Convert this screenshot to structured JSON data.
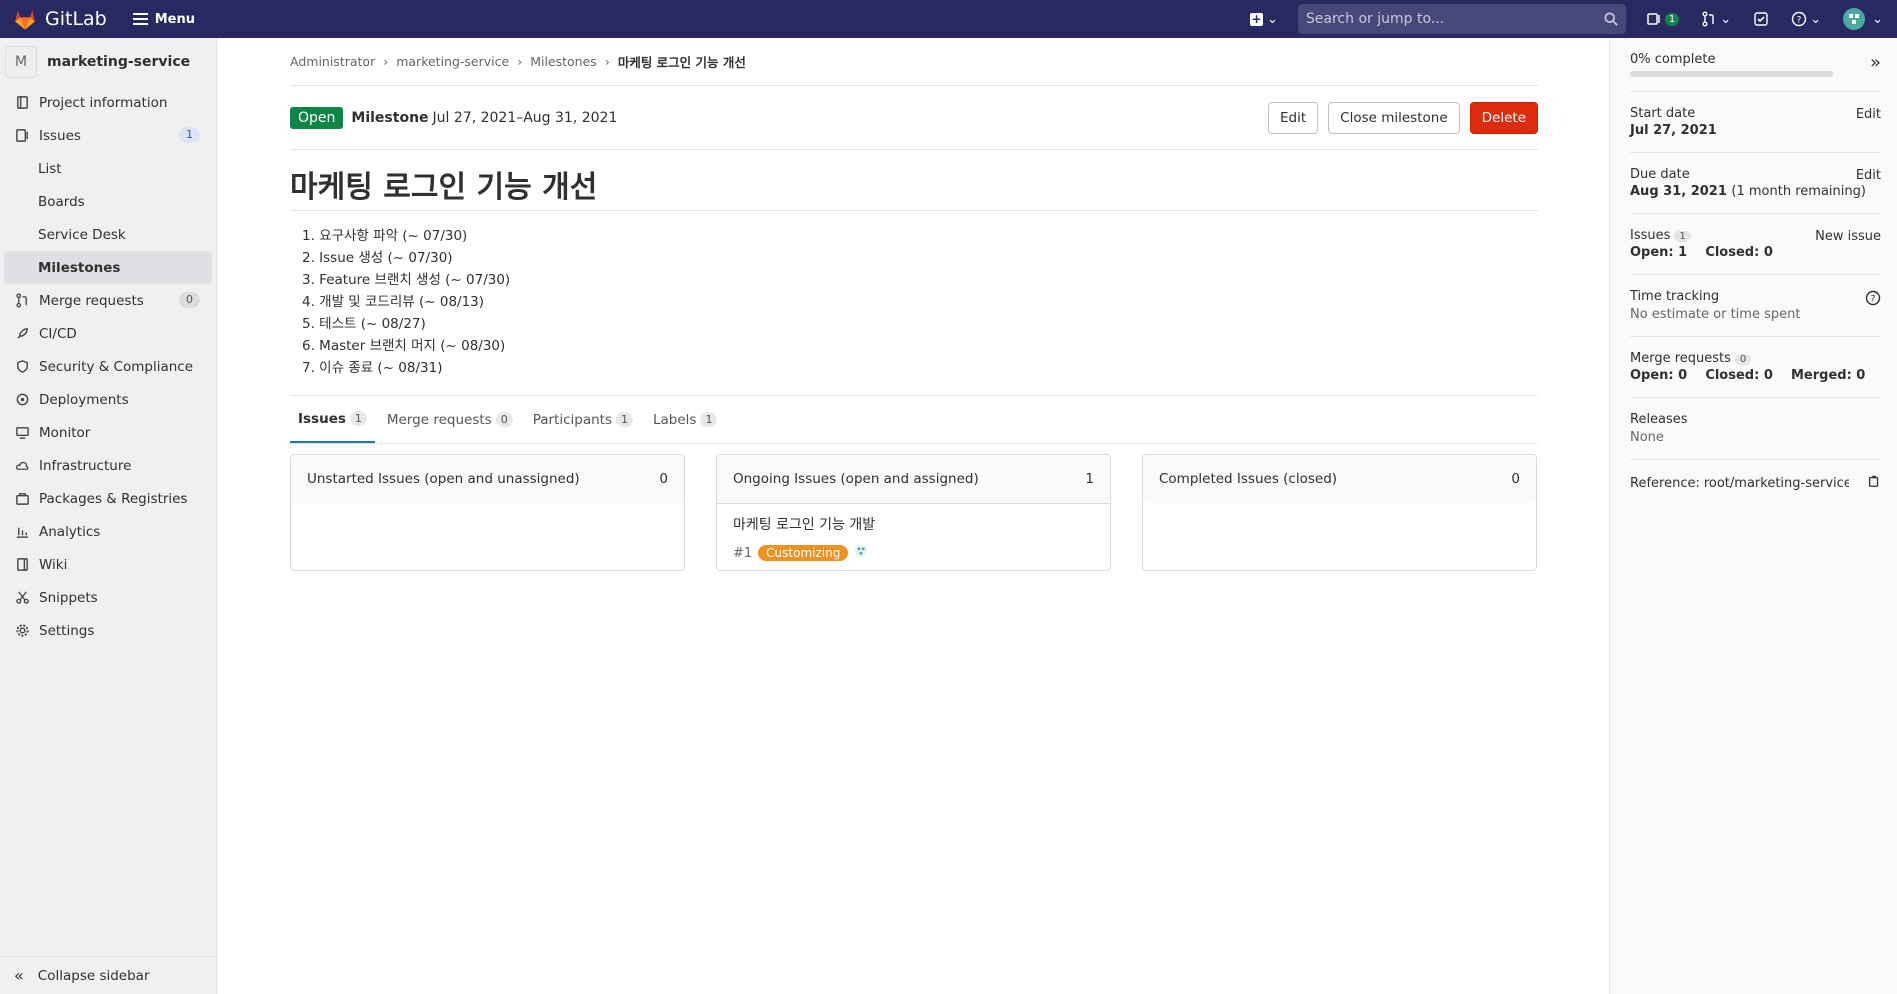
{
  "topbar": {
    "app_name": "GitLab",
    "menu_label": "Menu",
    "search_placeholder": "Search or jump to...",
    "issues_badge": "1"
  },
  "sidebar": {
    "project_initial": "M",
    "project_name": "marketing-service",
    "items": [
      {
        "label": "Project information"
      },
      {
        "label": "Issues",
        "count": "1"
      },
      {
        "label": "Merge requests",
        "count": "0"
      },
      {
        "label": "CI/CD"
      },
      {
        "label": "Security & Compliance"
      },
      {
        "label": "Deployments"
      },
      {
        "label": "Monitor"
      },
      {
        "label": "Infrastructure"
      },
      {
        "label": "Packages & Registries"
      },
      {
        "label": "Analytics"
      },
      {
        "label": "Wiki"
      },
      {
        "label": "Snippets"
      },
      {
        "label": "Settings"
      }
    ],
    "issue_subitems": [
      "List",
      "Boards",
      "Service Desk",
      "Milestones"
    ],
    "collapse_label": "Collapse sidebar"
  },
  "breadcrumb": [
    "Administrator",
    "marketing-service",
    "Milestones",
    "마케팅 로그인 기능 개선"
  ],
  "milestone": {
    "status": "Open",
    "label": "Milestone",
    "dates": "Jul 27, 2021–Aug 31, 2021",
    "edit_label": "Edit",
    "close_label": "Close milestone",
    "delete_label": "Delete",
    "title": "마케팅 로그인 기능 개선",
    "description": [
      "1. 요구사항 파악 (~ 07/30)",
      "2. Issue 생성 (~ 07/30)",
      "3. Feature 브랜치 생성 (~ 07/30)",
      "4. 개발 및 코드리뷰 (~ 08/13)",
      "5. 테스트 (~ 08/27)",
      "6. Master 브랜치 머지 (~ 08/30)",
      "7. 이슈 종료 (~ 08/31)"
    ]
  },
  "tabs": [
    {
      "label": "Issues",
      "count": "1"
    },
    {
      "label": "Merge requests",
      "count": "0"
    },
    {
      "label": "Participants",
      "count": "1"
    },
    {
      "label": "Labels",
      "count": "1"
    }
  ],
  "boards": [
    {
      "title": "Unstarted Issues (open and unassigned)",
      "count": "0"
    },
    {
      "title": "Ongoing Issues (open and assigned)",
      "count": "1"
    },
    {
      "title": "Completed Issues (closed)",
      "count": "0"
    }
  ],
  "issue": {
    "title": "마케팅 로그인 기능 개발",
    "ref": "#1",
    "label": "Customizing"
  },
  "right": {
    "progress_text": "0% complete",
    "progress": 0,
    "start_label": "Start date",
    "start_value": "Jul 27, 2021",
    "due_label": "Due date",
    "due_value": "Aug 31, 2021",
    "due_remaining": "(1 month remaining)",
    "edit": "Edit",
    "issues_label": "Issues",
    "issues_count": "1",
    "new_issue": "New issue",
    "issues_open": "Open: 1",
    "issues_closed": "Closed: 0",
    "time_label": "Time tracking",
    "time_value": "No estimate or time spent",
    "mr_label": "Merge requests",
    "mr_count": "0",
    "mr_open": "Open: 0",
    "mr_closed": "Closed: 0",
    "mr_merged": "Merged: 0",
    "releases_label": "Releases",
    "releases_value": "None",
    "reference_label": "Reference:",
    "reference_value": "root/marketing-service%"
  },
  "colors": {
    "topbar": "#292961",
    "open": "#108548",
    "delete": "#dd2b0e",
    "label_customizing": "#ed9121"
  }
}
